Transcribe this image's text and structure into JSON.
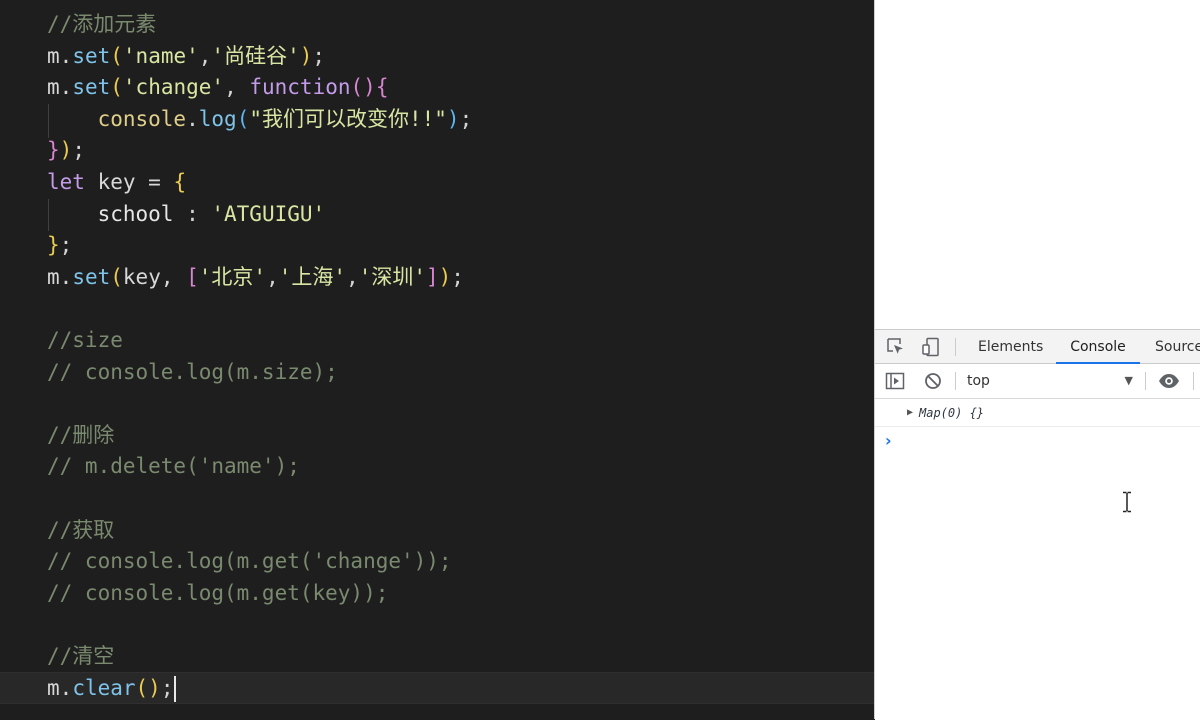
{
  "editor": {
    "lines": [
      {
        "row": 0,
        "tokens": [
          {
            "t": "//添加元素",
            "c": "cm"
          }
        ]
      },
      {
        "row": 1,
        "tokens": [
          {
            "t": "m",
            "c": "var"
          },
          {
            "t": ".",
            "c": "pun"
          },
          {
            "t": "set",
            "c": "mth"
          },
          {
            "t": "(",
            "c": "br1"
          },
          {
            "t": "'name'",
            "c": "str"
          },
          {
            "t": ",",
            "c": "pun"
          },
          {
            "t": "'尚硅谷'",
            "c": "str"
          },
          {
            "t": ")",
            "c": "br1"
          },
          {
            "t": ";",
            "c": "pun"
          }
        ]
      },
      {
        "row": 2,
        "tokens": [
          {
            "t": "m",
            "c": "var"
          },
          {
            "t": ".",
            "c": "pun"
          },
          {
            "t": "set",
            "c": "mth"
          },
          {
            "t": "(",
            "c": "br1"
          },
          {
            "t": "'change'",
            "c": "str"
          },
          {
            "t": ", ",
            "c": "pun"
          },
          {
            "t": "function",
            "c": "kw"
          },
          {
            "t": "()",
            "c": "br2"
          },
          {
            "t": "{",
            "c": "br2"
          }
        ]
      },
      {
        "row": 3,
        "tokens": [
          {
            "t": "    ",
            "c": "pun"
          },
          {
            "t": "console",
            "c": "fn"
          },
          {
            "t": ".",
            "c": "pun"
          },
          {
            "t": "log",
            "c": "mth"
          },
          {
            "t": "(",
            "c": "br3"
          },
          {
            "t": "\"我们可以改变你!!\"",
            "c": "str"
          },
          {
            "t": ")",
            "c": "br3"
          },
          {
            "t": ";",
            "c": "pun"
          }
        ]
      },
      {
        "row": 4,
        "tokens": [
          {
            "t": "}",
            "c": "br2"
          },
          {
            "t": ")",
            "c": "br1"
          },
          {
            "t": ";",
            "c": "pun"
          }
        ]
      },
      {
        "row": 5,
        "tokens": [
          {
            "t": "let",
            "c": "kw"
          },
          {
            "t": " key = ",
            "c": "var"
          },
          {
            "t": "{",
            "c": "br1"
          }
        ]
      },
      {
        "row": 6,
        "tokens": [
          {
            "t": "    ",
            "c": "pun"
          },
          {
            "t": "school",
            "c": "prop"
          },
          {
            "t": " : ",
            "c": "pun"
          },
          {
            "t": "'ATGUIGU'",
            "c": "str"
          }
        ]
      },
      {
        "row": 7,
        "tokens": [
          {
            "t": "}",
            "c": "br1"
          },
          {
            "t": ";",
            "c": "pun"
          }
        ]
      },
      {
        "row": 8,
        "tokens": [
          {
            "t": "m",
            "c": "var"
          },
          {
            "t": ".",
            "c": "pun"
          },
          {
            "t": "set",
            "c": "mth"
          },
          {
            "t": "(",
            "c": "br1"
          },
          {
            "t": "key, ",
            "c": "var"
          },
          {
            "t": "[",
            "c": "br2"
          },
          {
            "t": "'北京'",
            "c": "str"
          },
          {
            "t": ",",
            "c": "pun"
          },
          {
            "t": "'上海'",
            "c": "str"
          },
          {
            "t": ",",
            "c": "pun"
          },
          {
            "t": "'深圳'",
            "c": "str"
          },
          {
            "t": "]",
            "c": "br2"
          },
          {
            "t": ")",
            "c": "br1"
          },
          {
            "t": ";",
            "c": "pun"
          }
        ]
      },
      {
        "row": 10,
        "tokens": [
          {
            "t": "//size",
            "c": "cm"
          }
        ]
      },
      {
        "row": 11,
        "tokens": [
          {
            "t": "// console.log(m.size);",
            "c": "cm"
          }
        ]
      },
      {
        "row": 13,
        "tokens": [
          {
            "t": "//删除",
            "c": "cm"
          }
        ]
      },
      {
        "row": 14,
        "tokens": [
          {
            "t": "// m.delete('name');",
            "c": "cm"
          }
        ]
      },
      {
        "row": 16,
        "tokens": [
          {
            "t": "//获取",
            "c": "cm"
          }
        ]
      },
      {
        "row": 17,
        "tokens": [
          {
            "t": "// console.log(m.get('change'));",
            "c": "cm"
          }
        ]
      },
      {
        "row": 18,
        "tokens": [
          {
            "t": "// console.log(m.get(key));",
            "c": "cm"
          }
        ]
      },
      {
        "row": 20,
        "tokens": [
          {
            "t": "//清空",
            "c": "cm"
          }
        ]
      },
      {
        "row": 21,
        "current": true,
        "tokens": [
          {
            "t": "m",
            "c": "var"
          },
          {
            "t": ".",
            "c": "pun"
          },
          {
            "t": "clear",
            "c": "mth"
          },
          {
            "t": "()",
            "c": "br1"
          },
          {
            "t": ";",
            "c": "pun"
          }
        ]
      }
    ]
  },
  "devtools": {
    "tabs": [
      {
        "label": "Elements",
        "active": false
      },
      {
        "label": "Console",
        "active": true
      },
      {
        "label": "Source",
        "active": false
      }
    ],
    "toolbar_icons": [
      "inspect-element-icon",
      "device-toolbar-icon"
    ],
    "console_toolbar_icons": [
      "sidebar-toggle-icon",
      "clear-console-icon",
      "eye-icon"
    ],
    "context": "top",
    "messages": [
      {
        "text": "Map(0) {}"
      }
    ],
    "prompt_symbol": "›"
  },
  "colors": {
    "editor_bg": "#1e1e1e",
    "comment": "#7a8a6f",
    "string": "#d7e7a3",
    "keyword": "#c49be8",
    "method": "#7fc4e8",
    "accent_tab": "#1a73e8"
  }
}
